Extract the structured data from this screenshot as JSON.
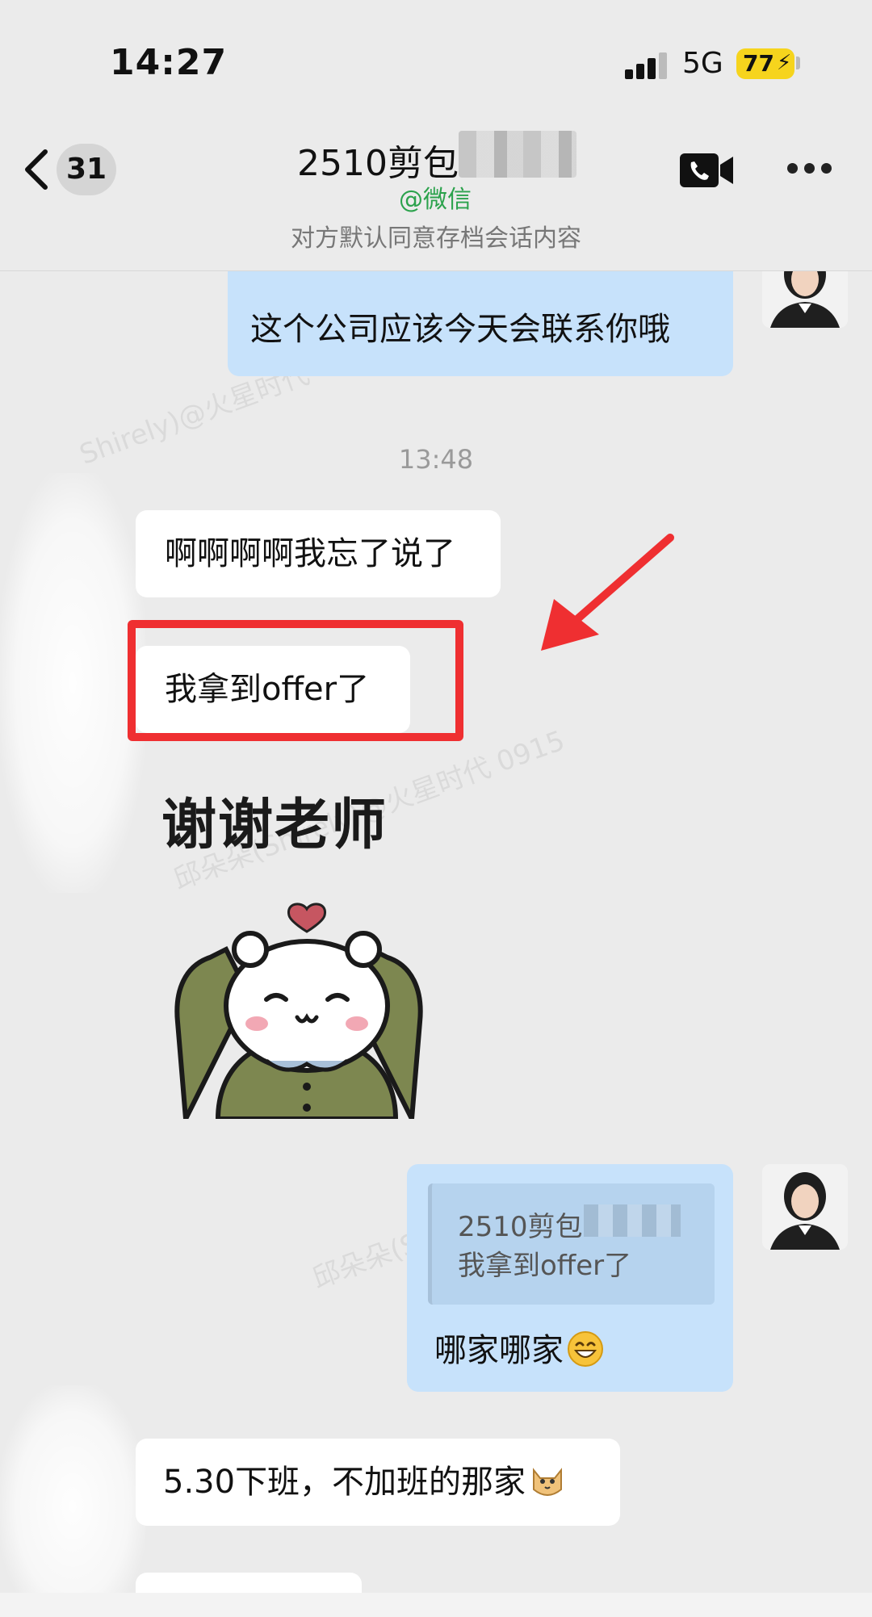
{
  "status_bar": {
    "time": "14:27",
    "network": "5G",
    "battery": "77"
  },
  "header": {
    "unread_count": "31",
    "title": "2510剪包",
    "subtitle": "@微信",
    "archive_note": "对方默认同意存档会话内容"
  },
  "messages": {
    "out_1": "这个公司应该今天会联系你哦",
    "timestamp": "13:48",
    "in_1": "啊啊啊啊我忘了说了",
    "in_2": "我拿到offer了",
    "sticker_text": "谢谢老师",
    "quote_name": "2510剪包",
    "quote_text": "我拿到offer了",
    "out_2": "哪家哪家",
    "in_3": "5.30下班，不加班的那家"
  },
  "colors": {
    "outgoing_bubble": "#c7e2fb",
    "incoming_bubble": "#ffffff",
    "highlight": "#ef2f31",
    "subtitle_green": "#2ba24c"
  }
}
